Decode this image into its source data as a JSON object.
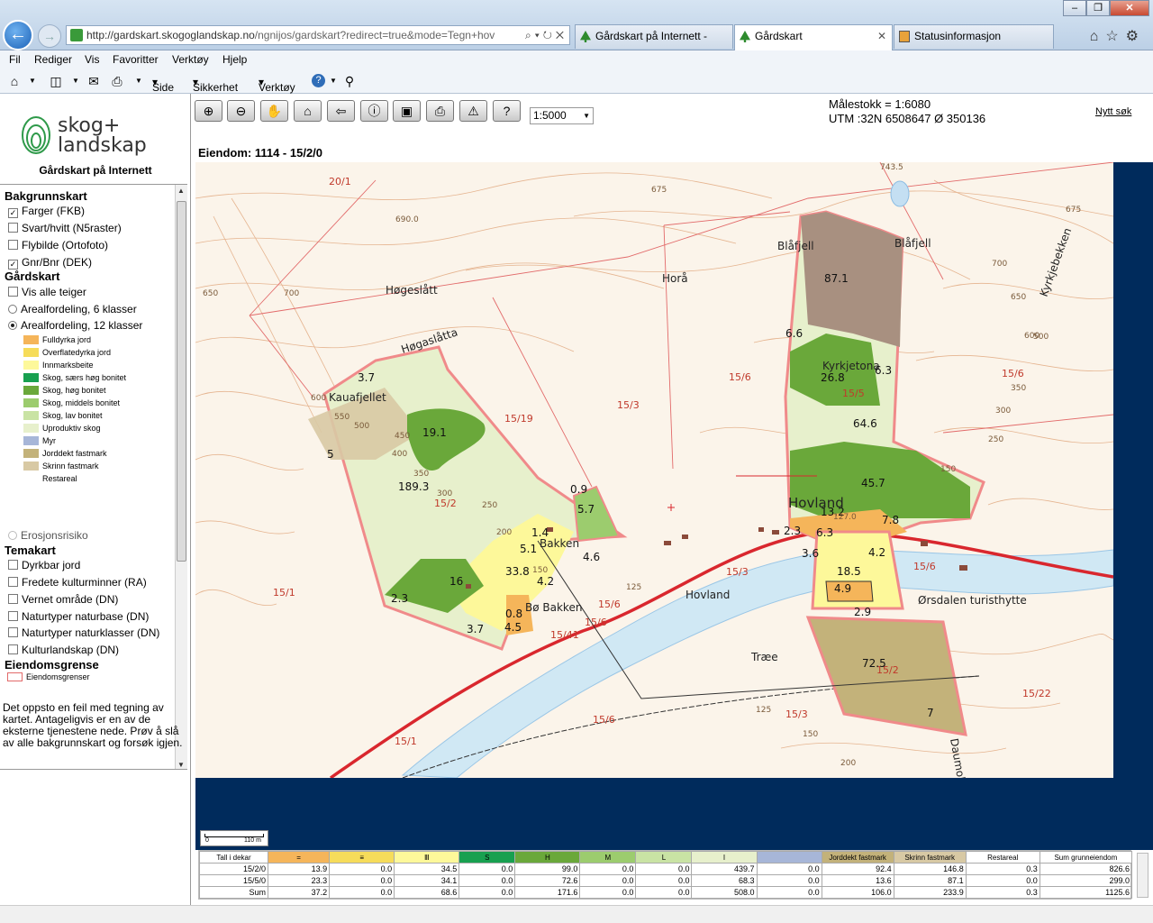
{
  "browser": {
    "url_host": "http://gardskart.skogoglandskap.no",
    "url_path": "/ngnijos/gardskart?redirect=true&mode=Tegn+hov",
    "tabs": [
      {
        "label": "Gårdskart på Internett -"
      },
      {
        "label": "Gårdskart"
      },
      {
        "label": "Statusinformasjon"
      }
    ],
    "menu": [
      "Fil",
      "Rediger",
      "Vis",
      "Favoritter",
      "Verktøy",
      "Hjelp"
    ],
    "commands": [
      "Side",
      "Sikkerhet",
      "Verktøy"
    ]
  },
  "sidebar": {
    "logo_line1": "skog+",
    "logo_line2": "landskap",
    "subtitle": "Gårdskart på Internett",
    "bakgrunnskart": {
      "title": "Bakgrunnskart",
      "items": [
        {
          "label": "Farger (FKB)",
          "checked": true
        },
        {
          "label": "Svart/hvitt (N5raster)",
          "checked": false
        },
        {
          "label": "Flybilde (Ortofoto)",
          "checked": false
        },
        {
          "label": "Gnr/Bnr (DEK)",
          "checked": true
        }
      ]
    },
    "gardskart": {
      "title": "Gårdskart",
      "vis_alle": "Vis alle teiger",
      "radio6": "Arealfordeling, 6 klasser",
      "radio12": "Arealfordeling, 12 klasser"
    },
    "legend": [
      {
        "label": "Fulldyrka jord",
        "color": "#f5b55a"
      },
      {
        "label": "Overflatedyrka jord",
        "color": "#f6dc5a"
      },
      {
        "label": "Innmarksbeite",
        "color": "#fdf89a"
      },
      {
        "label": "Skog, særs høg bonitet",
        "color": "#18a050"
      },
      {
        "label": "Skog, høg bonitet",
        "color": "#6aa83a"
      },
      {
        "label": "Skog, middels bonitet",
        "color": "#9ccc6e"
      },
      {
        "label": "Skog, lav bonitet",
        "color": "#c9e3a4"
      },
      {
        "label": "Uproduktiv skog",
        "color": "#e7f0cc"
      },
      {
        "label": "Myr",
        "color": "#a7b6d8"
      },
      {
        "label": "Jorddekt fastmark",
        "color": "#c3b27a"
      },
      {
        "label": "Skrinn fastmark",
        "color": "#d8c9a4"
      },
      {
        "label": "Restareal",
        "color": "#ffffff"
      }
    ],
    "erosjon": "Erosjonsrisiko",
    "temakart": {
      "title": "Temakart",
      "items": [
        {
          "label": "Dyrkbar jord"
        },
        {
          "label": "Fredete kulturminner (RA)"
        },
        {
          "label": "Vernet område (DN)"
        },
        {
          "label": "Naturtyper naturbase (DN)"
        },
        {
          "label": "Naturtyper naturklasser (DN)"
        },
        {
          "label": "Kulturlandskap (DN)"
        }
      ]
    },
    "eiendomsgrense": {
      "title": "Eiendomsgrense",
      "item": "Eiendomsgrenser"
    },
    "error_message": "Det oppsto en feil med tegning av kartet. Antageligvis er en av de eksterne tjenestene nede. Prøv å slå av alle bakgrunnskart og forsøk igjen."
  },
  "toolbar": {
    "scale_select": "1:5000",
    "malestokk": "Målestokk = 1:6080",
    "utm": "UTM :32N 6508647 Ø 350136",
    "nytt_sok": "Nytt søk",
    "eiendom": "Eiendom: 1114 - 15/2/0"
  },
  "map": {
    "place_names": [
      "Høgeslått",
      "Høgaslåtta",
      "Kauafjellet",
      "Horå",
      "Blåfjell",
      "Blåfjell",
      "Kyrkjetona",
      "Hovland",
      "Hovland",
      "Bakken",
      "Bø Bakken",
      "Træe",
      "Ørsdalen turisthytte",
      "Kyrkjebekken",
      "Daumoltj"
    ],
    "parcel_labels": [
      "20/1",
      "15/2",
      "15/19",
      "15/3",
      "15/6",
      "15/5",
      "15/6",
      "15/3",
      "15/6",
      "15/6",
      "15/41",
      "15/1",
      "15/1",
      "15/2",
      "15/3",
      "15/22",
      "15/6",
      "15/6"
    ],
    "area_values": [
      "87.1",
      "6.6",
      "26.8",
      "6.3",
      "64.6",
      "45.7",
      "13.2",
      "6.3",
      "2.3",
      "7.8",
      "3.6",
      "4.2",
      "18.5",
      "4.9",
      "2.9",
      "72.5",
      "7",
      "3.7",
      "5",
      "19.1",
      "189.3",
      "0.9",
      "5.7",
      "5.1",
      "4.6",
      "33.8",
      "4.2",
      "16",
      "2.3",
      "0.8",
      "4.5",
      "3.7",
      "1.4"
    ],
    "contour_labels": [
      "690.0",
      "675",
      "650",
      "700",
      "600",
      "550",
      "500",
      "450",
      "400",
      "350",
      "300",
      "250",
      "200",
      "150",
      "125",
      "743.5",
      "675",
      "700",
      "650",
      "600",
      "500",
      "350",
      "300",
      "250",
      "150",
      "127.0",
      "125",
      "150",
      "200"
    ],
    "scalebar": {
      "start": "0",
      "end": "110 m"
    }
  },
  "table": {
    "headers": [
      "Tall i dekar",
      "=",
      "≡",
      "Ⅲ",
      "S",
      "H",
      "M",
      "L",
      "I",
      "",
      "Jorddekt fastmark",
      "Skrinn fastmark",
      "Restareal",
      "Sum grunneiendom"
    ],
    "header_colors": [
      "#ffffff",
      "#f5b55a",
      "#f6dc5a",
      "#fdf89a",
      "#18a050",
      "#6aa83a",
      "#9ccc6e",
      "#c9e3a4",
      "#e7f0cc",
      "#a7b6d8",
      "#c3b27a",
      "#d8c9a4",
      "#ffffff",
      "#ffffff"
    ],
    "rows": [
      [
        "15/2/0",
        "13.9",
        "0.0",
        "34.5",
        "0.0",
        "99.0",
        "0.0",
        "0.0",
        "439.7",
        "0.0",
        "92.4",
        "146.8",
        "0.3",
        "826.6"
      ],
      [
        "15/5/0",
        "23.3",
        "0.0",
        "34.1",
        "0.0",
        "72.6",
        "0.0",
        "0.0",
        "68.3",
        "0.0",
        "13.6",
        "87.1",
        "0.0",
        "299.0"
      ],
      [
        "Sum",
        "37.2",
        "0.0",
        "68.6",
        "0.0",
        "171.6",
        "0.0",
        "0.0",
        "508.0",
        "0.0",
        "106.0",
        "233.9",
        "0.3",
        "1125.6"
      ]
    ]
  }
}
